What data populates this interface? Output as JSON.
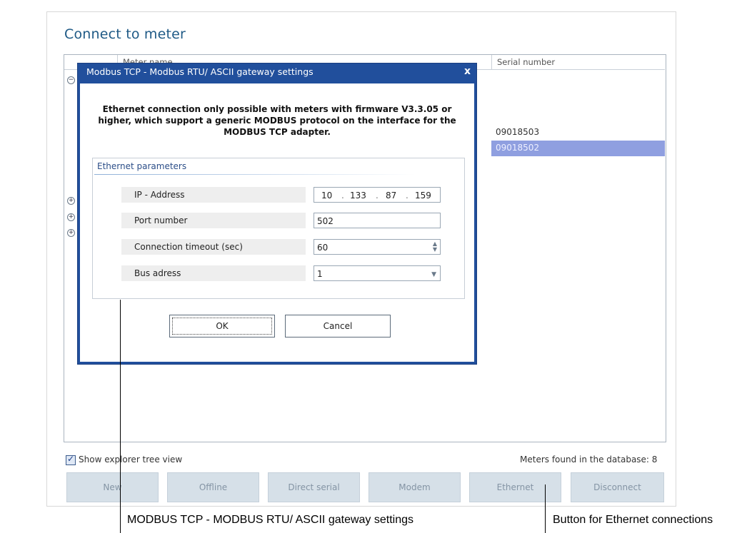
{
  "page": {
    "title": "Connect to meter"
  },
  "grid": {
    "columns": [
      "Meter name",
      "Serial number"
    ],
    "serials": [
      "09018503",
      "09018502"
    ]
  },
  "dialog": {
    "title": "Modbus TCP - Modbus RTU/ ASCII gateway settings",
    "close_label": "x",
    "notice": "Ethernet connection only possible with meters with firmware V3.3.05 or higher, which support a generic MODBUS protocol on the interface for the MODBUS TCP adapter.",
    "group_label": "Ethernet parameters",
    "params": {
      "ip_label": "IP - Address",
      "ip_octets": [
        "10",
        "133",
        "87",
        "159"
      ],
      "port_label": "Port number",
      "port_value": "502",
      "timeout_label": "Connection timeout (sec)",
      "timeout_value": "60",
      "bus_label": "Bus adress",
      "bus_value": "1"
    },
    "ok_label": "OK",
    "cancel_label": "Cancel"
  },
  "footer": {
    "show_tree_label": "Show explorer tree view",
    "show_tree_checked": true,
    "meters_found": "Meters found in the database: 8"
  },
  "buttons": [
    "New",
    "Offline",
    "Direct serial",
    "Modem",
    "Ethernet",
    "Disconnect"
  ],
  "callouts": {
    "left": "MODBUS TCP -  MODBUS RTU/ ASCII gateway settings",
    "right": "Button for Ethernet connections"
  },
  "colors": {
    "title_blue": "#1f5a86",
    "dialog_titlebar": "#214f9c",
    "selected_row": "#8f9fe0",
    "button_disabled_bg": "#d6e0e8"
  },
  "icons": [
    "expand-icon",
    "collapse-icon",
    "close-icon",
    "checkbox-checked-icon",
    "spinner-arrows-icon",
    "dropdown-arrow-icon"
  ]
}
